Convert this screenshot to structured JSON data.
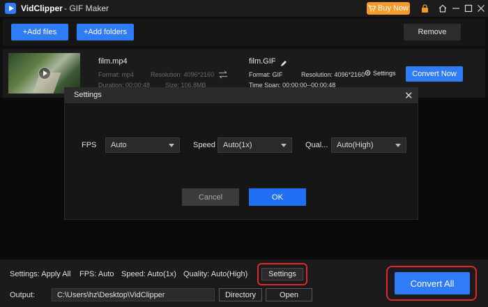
{
  "titlebar": {
    "app_name": "VidClipper",
    "subtitle": "- GIF Maker",
    "buy_label": "Buy Now",
    "icons": [
      "logo-icon",
      "cart-icon",
      "lock-icon",
      "home-icon",
      "minimize-icon",
      "maximize-icon",
      "close-icon"
    ]
  },
  "toolbar": {
    "add_files": "+Add files",
    "add_folders": "+Add folders",
    "remove": "Remove"
  },
  "file": {
    "source_name": "film.mp4",
    "source_format": "Format: mp4",
    "source_resolution": "Resolution: 4096*2160",
    "source_duration": "Duration: 00:00:48",
    "source_size": "Size: 106.8MB",
    "output_name": "film.GIF",
    "output_format": "Format: GIF",
    "output_resolution": "Resolution: 4096*2160",
    "output_span": "Time Span: 00:00:00--00:00:48",
    "settings_link": "Settings",
    "convert_now": "Convert Now"
  },
  "modal": {
    "title": "Settings",
    "fps_label": "FPS",
    "fps_value": "Auto",
    "speed_label": "Speed",
    "speed_value": "Auto(1x)",
    "quality_label": "Qual...",
    "quality_value": "Auto(High)",
    "cancel": "Cancel",
    "ok": "OK"
  },
  "bottom": {
    "settings_summary": "Settings: Apply All",
    "fps": "FPS: Auto",
    "speed": "Speed: Auto(1x)",
    "quality": "Quality: Auto(High)",
    "settings_button": "Settings",
    "output_label": "Output:",
    "output_path": "C:\\Users\\hz\\Desktop\\VidClipper",
    "directory": "Directory",
    "open": "Open",
    "convert_all": "Convert All"
  },
  "colors": {
    "accent": "#2f7cf6",
    "buy": "#f39a2b",
    "highlight": "#e0262a"
  }
}
